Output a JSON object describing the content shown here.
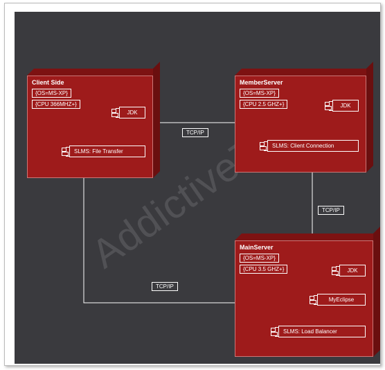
{
  "watermark": "AddictiveTips",
  "nodes": {
    "client": {
      "title": "Client Side",
      "tags": {
        "os": "{OS=MS-XP}",
        "cpu": "{CPU 366MHZ+}"
      },
      "components": {
        "jdk": "JDK",
        "slms": "SLMS: File Transfer"
      }
    },
    "member": {
      "title": "MemberServer",
      "tags": {
        "os": "{OS=MS-XP}",
        "cpu": "{CPU 2.5 GHZ+}"
      },
      "components": {
        "jdk": "JDK",
        "slms": "SLMS: Client Connection"
      }
    },
    "main": {
      "title": "MainServer",
      "tags": {
        "os": "{OS=MS-XP}",
        "cpu": "{CPU 3.5 GHZ+}"
      },
      "components": {
        "jdk": "JDK",
        "myeclipse": "MyEclipse",
        "slms": "SLMS: Load Balancer"
      }
    }
  },
  "connections": {
    "client_member": "TCP/IP",
    "member_main": "TCP/IP",
    "client_main": "TCP/IP"
  }
}
